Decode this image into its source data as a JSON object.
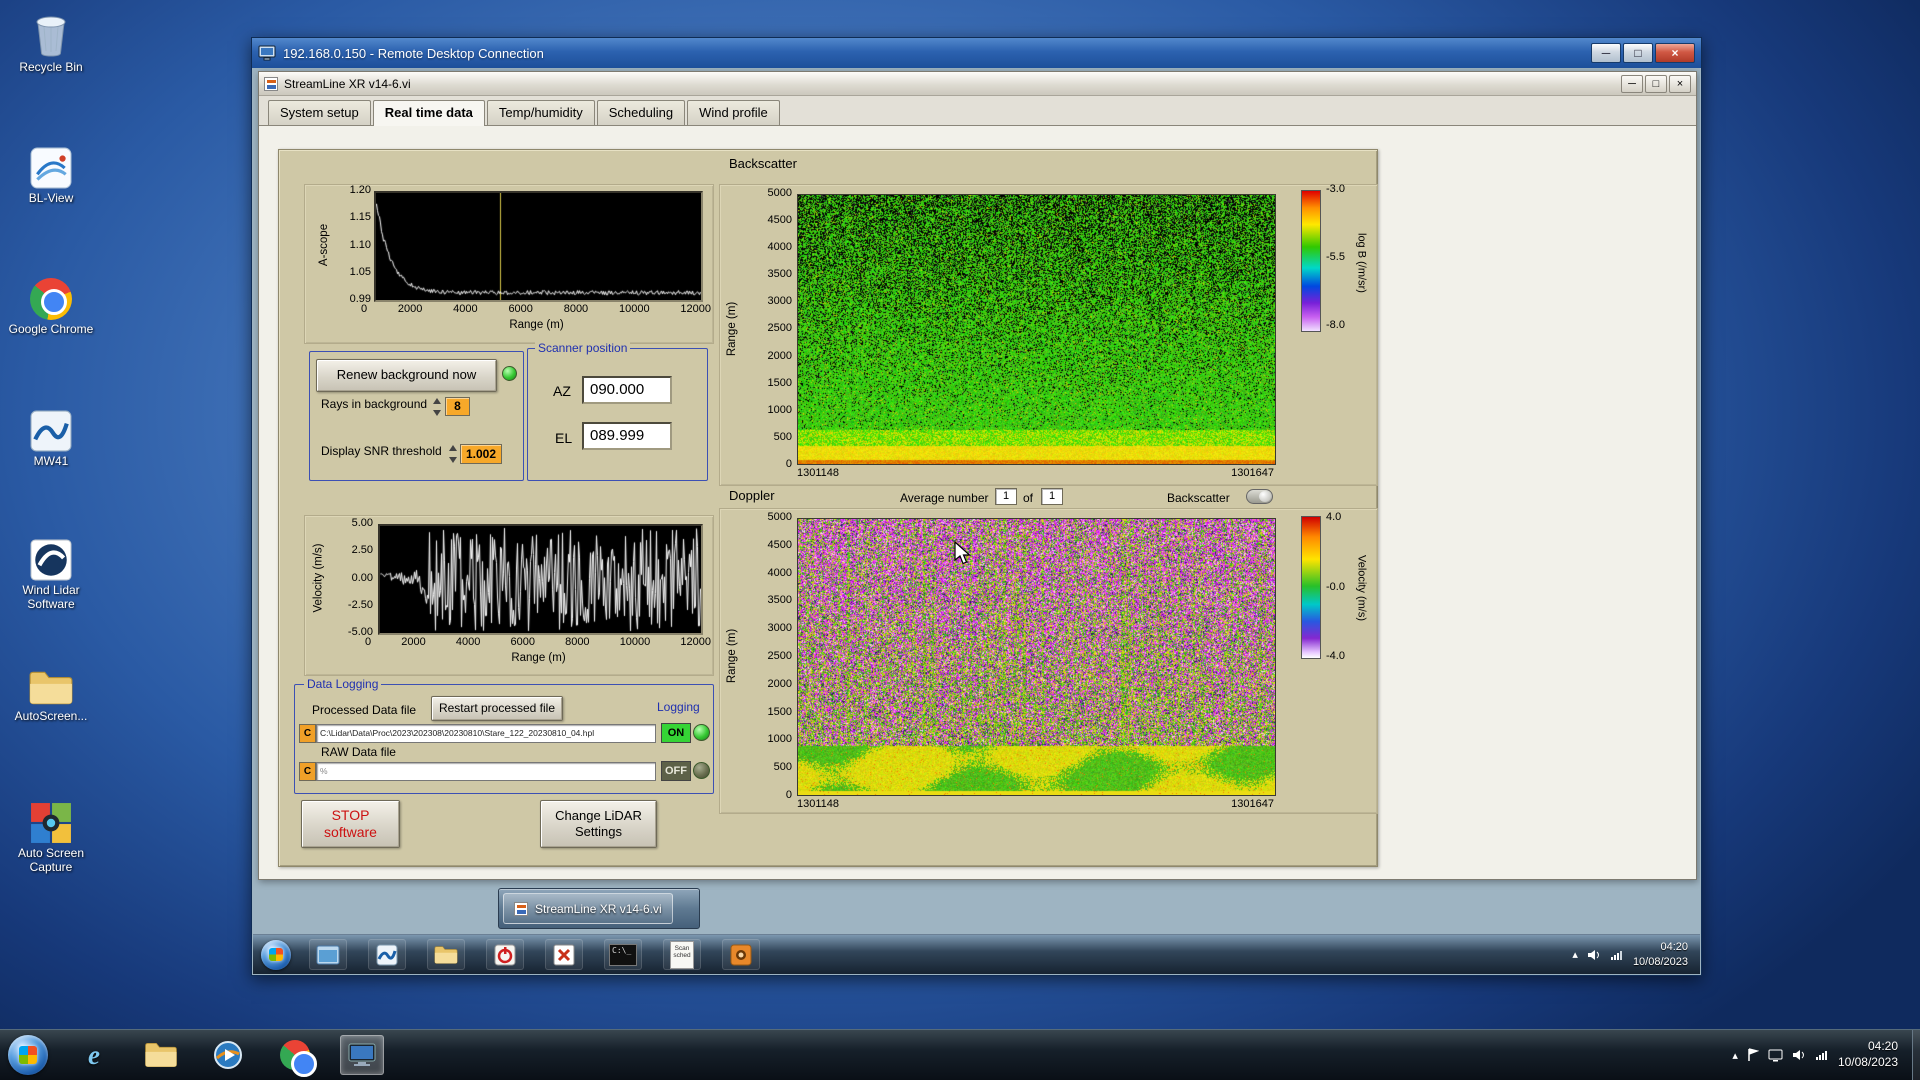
{
  "desktop": {
    "icons": [
      {
        "label": "Recycle Bin"
      },
      {
        "label": "BL-View"
      },
      {
        "label": "Google Chrome"
      },
      {
        "label": "MW41"
      },
      {
        "label": "Wind Lidar Software"
      },
      {
        "label": "AutoScreen..."
      },
      {
        "label": "Auto Screen Capture"
      }
    ]
  },
  "rdp": {
    "title": "192.168.0.150 - Remote Desktop Connection"
  },
  "remote": {
    "taskbar_button": "StreamLine XR v14-6.vi",
    "scan_icon_label": "Scan sched",
    "tray_time": "04:20",
    "tray_date": "10/08/2023"
  },
  "host": {
    "tray_time": "04:20",
    "tray_date": "10/08/2023"
  },
  "app": {
    "title": "StreamLine XR v14-6.vi",
    "tabs": [
      {
        "label": "System setup"
      },
      {
        "label": "Real time data"
      },
      {
        "label": "Temp/humidity"
      },
      {
        "label": "Scheduling"
      },
      {
        "label": "Wind profile"
      }
    ],
    "ascope": {
      "ylabel": "A-scope",
      "yticks": [
        "1.20",
        "1.15",
        "1.10",
        "1.05",
        "0.99"
      ],
      "xticks": [
        "0",
        "2000",
        "4000",
        "6000",
        "8000",
        "10000",
        "12000"
      ],
      "xlabel": "Range (m)"
    },
    "controls": {
      "renew_button": "Renew background now",
      "rays_label": "Rays in background",
      "rays_value": "8",
      "snr_label": "Display SNR threshold",
      "snr_value": "1.002"
    },
    "scanner": {
      "title": "Scanner position",
      "az_label": "AZ",
      "az_value": "090.000",
      "el_label": "EL",
      "el_value": "089.999"
    },
    "backscatter": {
      "title": "Backscatter",
      "ylabel": "Range (m)",
      "yticks": [
        "5000",
        "4500",
        "4000",
        "3500",
        "3000",
        "2500",
        "2000",
        "1500",
        "1000",
        "500",
        "0"
      ],
      "x_start": "1301148",
      "x_end": "1301647",
      "cb_ticks": [
        "-3.0",
        "-5.5",
        "-8.0"
      ],
      "cb_label": "log B (/m/sr)"
    },
    "doppler": {
      "title": "Doppler",
      "avg_label": "Average number",
      "avg_value": "1",
      "of_label": "of",
      "of_value": "1",
      "toggle_label": "Backscatter",
      "ylabel": "Range (m)",
      "yticks": [
        "5000",
        "4500",
        "4000",
        "3500",
        "3000",
        "2500",
        "2000",
        "1500",
        "1000",
        "500",
        "0"
      ],
      "x_start": "1301148",
      "x_end": "1301647",
      "cb_ticks": [
        "4.0",
        "-0.0",
        "-4.0"
      ],
      "cb_label": "Velocity (m/s)"
    },
    "velocity": {
      "ylabel": "Velocity (m/s)",
      "yticks": [
        "5.00",
        "2.50",
        "0.00",
        "-2.50",
        "-5.00"
      ],
      "xticks": [
        "0",
        "2000",
        "4000",
        "6000",
        "8000",
        "10000",
        "12000"
      ],
      "xlabel": "Range (m)"
    },
    "logging": {
      "title": "Data Logging",
      "processed_label": "Processed Data file",
      "restart_button": "Restart processed file",
      "logging_label": "Logging",
      "drive_label": "C",
      "processed_path": "C:\\Lidar\\Data\\Proc\\2023\\202308\\20230810\\Stare_122_20230810_04.hpl",
      "on_label": "ON",
      "raw_label": "RAW Data file",
      "raw_mark": "%",
      "off_label": "OFF"
    },
    "stop_button": {
      "line1": "STOP",
      "line2": "software"
    },
    "change_button": {
      "line1": "Change LiDAR",
      "line2": "Settings"
    }
  }
}
